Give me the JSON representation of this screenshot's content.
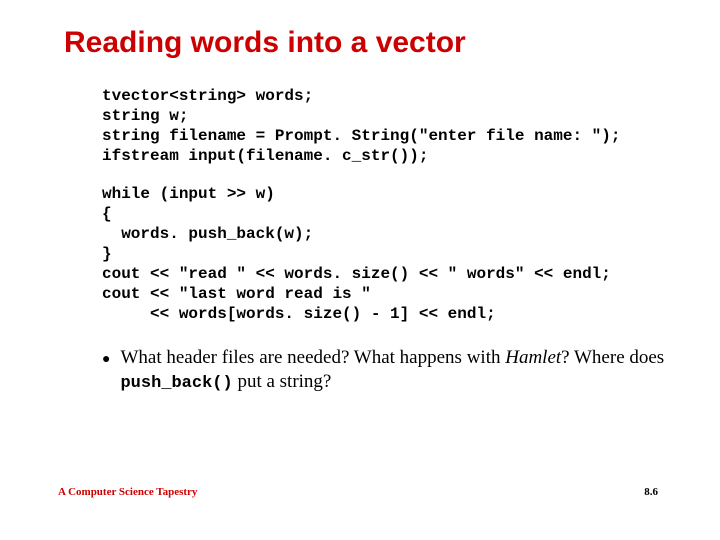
{
  "title": "Reading words into a vector",
  "code_block1": "tvector<string> words;\nstring w;\nstring filename = Prompt. String(\"enter file name: \");\nifstream input(filename. c_str());",
  "code_block2": "while (input >> w)\n{\n  words. push_back(w);\n}\ncout << \"read \" << words. size() << \" words\" << endl;\ncout << \"last word read is \"\n     << words[words. size() - 1] << endl;",
  "bullet": {
    "prefix": "What header files are needed?  What happens with ",
    "italic": "Hamlet",
    "mid": "? Where does ",
    "mono": "push_back()",
    "suffix": " put a string?"
  },
  "footer": {
    "left": "A Computer Science Tapestry",
    "right": "8.6"
  }
}
